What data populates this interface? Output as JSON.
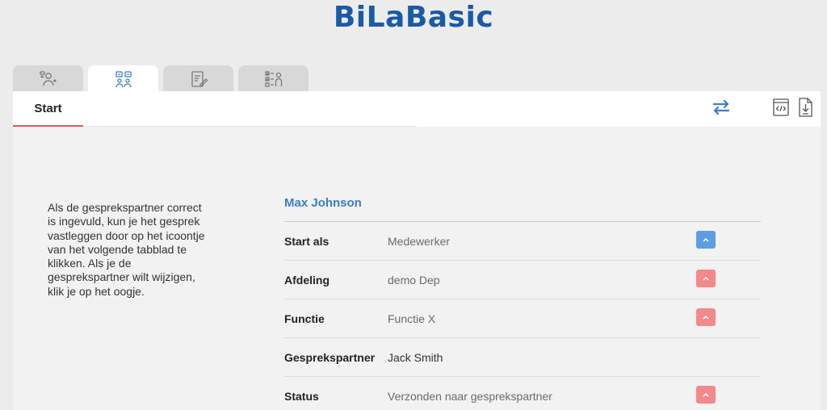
{
  "app": {
    "title": "BiLaBasic"
  },
  "tabs": [
    {
      "name": "tab-persons",
      "icon": "person-swap-icon",
      "active": false
    },
    {
      "name": "tab-conversation",
      "icon": "people-chat-icon",
      "active": true
    },
    {
      "name": "tab-edit",
      "icon": "document-edit-icon",
      "active": false
    },
    {
      "name": "tab-checklist",
      "icon": "checklist-person-icon",
      "active": false
    }
  ],
  "header": {
    "start_label": "Start",
    "icons": [
      "swap-arrows-icon",
      "code-document-icon",
      "download-document-icon"
    ]
  },
  "help": {
    "text": "Als de gesprekspartner correct is ingevuld, kun je het gesprek vastleggen door op het icoontje van het volgende tabblad te klikken. Als je de gesprekspartner wilt wijzigen, klik je op het oogje."
  },
  "person": {
    "name": "Max Johnson",
    "rows": [
      {
        "label": "Start als",
        "value": "Medewerker",
        "button": "blue"
      },
      {
        "label": "Afdeling",
        "value": "demo Dep",
        "button": "red"
      },
      {
        "label": "Functie",
        "value": "Functie X",
        "button": "red"
      },
      {
        "label": "Gesprekspartner",
        "value": "Jack Smith",
        "button": "none"
      },
      {
        "label": "Status",
        "value": "Verzonden naar gesprekspartner",
        "button": "red"
      }
    ]
  },
  "colors": {
    "brand": "#1a5aa6",
    "accent_red": "#e2584a",
    "name_blue": "#3b7dc9",
    "button_blue": "#5b9fe0",
    "button_red": "#f2898a"
  }
}
